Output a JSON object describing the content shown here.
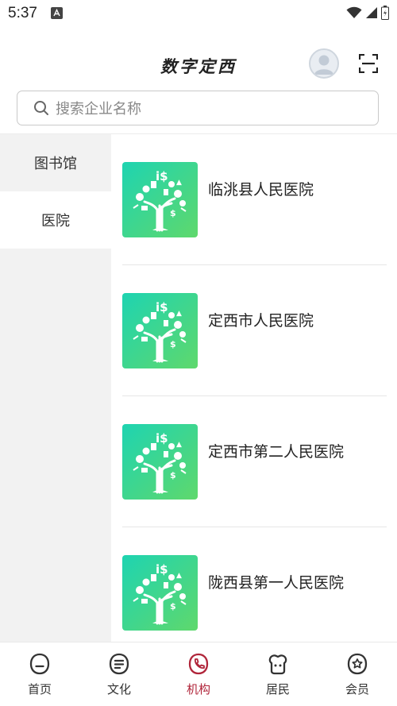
{
  "status_bar": {
    "time": "5:37"
  },
  "header": {
    "title": "数字定西"
  },
  "search": {
    "placeholder": "搜索企业名称"
  },
  "sidebar": {
    "items": [
      {
        "label": "图书馆",
        "active": false
      },
      {
        "label": "医院",
        "active": true
      }
    ]
  },
  "list": {
    "items": [
      {
        "title": "临洮县人民医院"
      },
      {
        "title": "定西市人民医院"
      },
      {
        "title": "定西市第二人民医院"
      },
      {
        "title": "陇西县第一人民医院"
      }
    ]
  },
  "tabbar": {
    "items": [
      {
        "label": "首页",
        "icon": "home-icon"
      },
      {
        "label": "文化",
        "icon": "culture-icon"
      },
      {
        "label": "机构",
        "icon": "institution-icon",
        "active": true
      },
      {
        "label": "居民",
        "icon": "resident-icon"
      },
      {
        "label": "会员",
        "icon": "member-icon"
      }
    ]
  },
  "colors": {
    "accent": "#b0253a",
    "thumb_start": "#1ed4b1",
    "thumb_end": "#5fd86c"
  }
}
